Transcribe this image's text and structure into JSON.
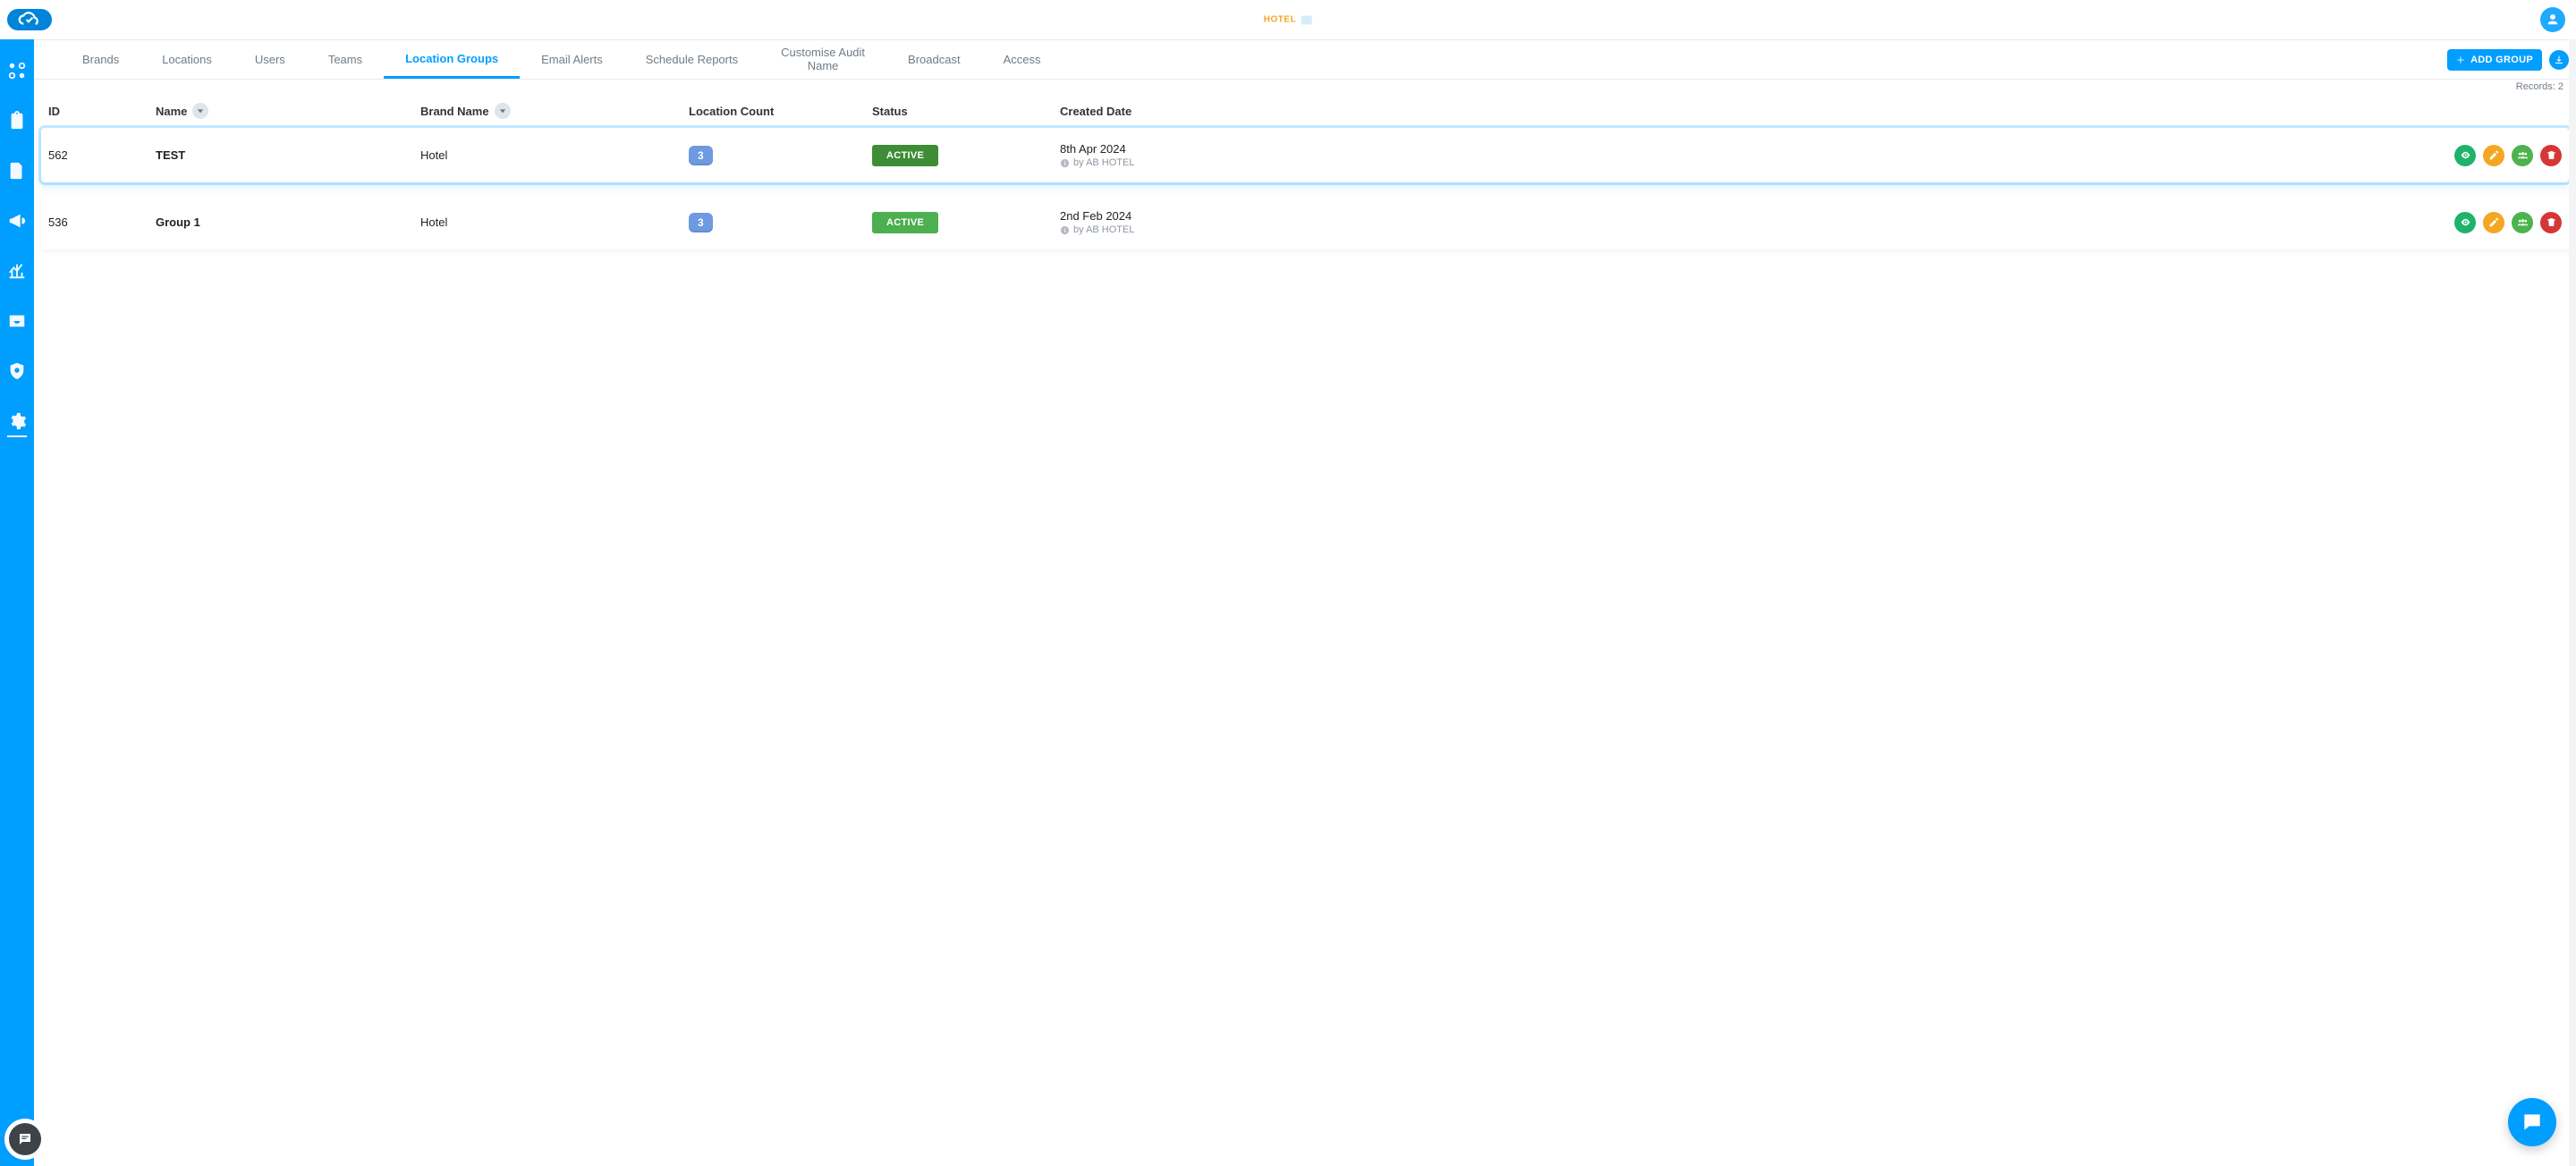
{
  "brand_center_label": "HOTEL",
  "add_button_label": "ADD GROUP",
  "records_label_prefix": "Records: ",
  "records_count": 2,
  "tabs": [
    {
      "label": "Brands",
      "active": false
    },
    {
      "label": "Locations",
      "active": false
    },
    {
      "label": "Users",
      "active": false
    },
    {
      "label": "Teams",
      "active": false
    },
    {
      "label": "Location Groups",
      "active": true
    },
    {
      "label": "Email Alerts",
      "active": false
    },
    {
      "label": "Schedule Reports",
      "active": false
    },
    {
      "label_line1": "Customise Audit",
      "label_line2": "Name",
      "active": false,
      "twoline": true
    },
    {
      "label": "Broadcast",
      "active": false
    },
    {
      "label": "Access",
      "active": false
    }
  ],
  "columns": {
    "id": "ID",
    "name": "Name",
    "brand": "Brand Name",
    "location_count": "Location Count",
    "status": "Status",
    "created": "Created Date"
  },
  "rows": [
    {
      "id": "562",
      "name": "TEST",
      "brand": "Hotel",
      "location_count": "3",
      "status": "ACTIVE",
      "created_date": "8th Apr 2024",
      "created_by": "by AB HOTEL",
      "highlight": true
    },
    {
      "id": "536",
      "name": "Group 1",
      "brand": "Hotel",
      "location_count": "3",
      "status": "ACTIVE",
      "created_date": "2nd Feb 2024",
      "created_by": "by AB HOTEL",
      "highlight": false
    }
  ]
}
